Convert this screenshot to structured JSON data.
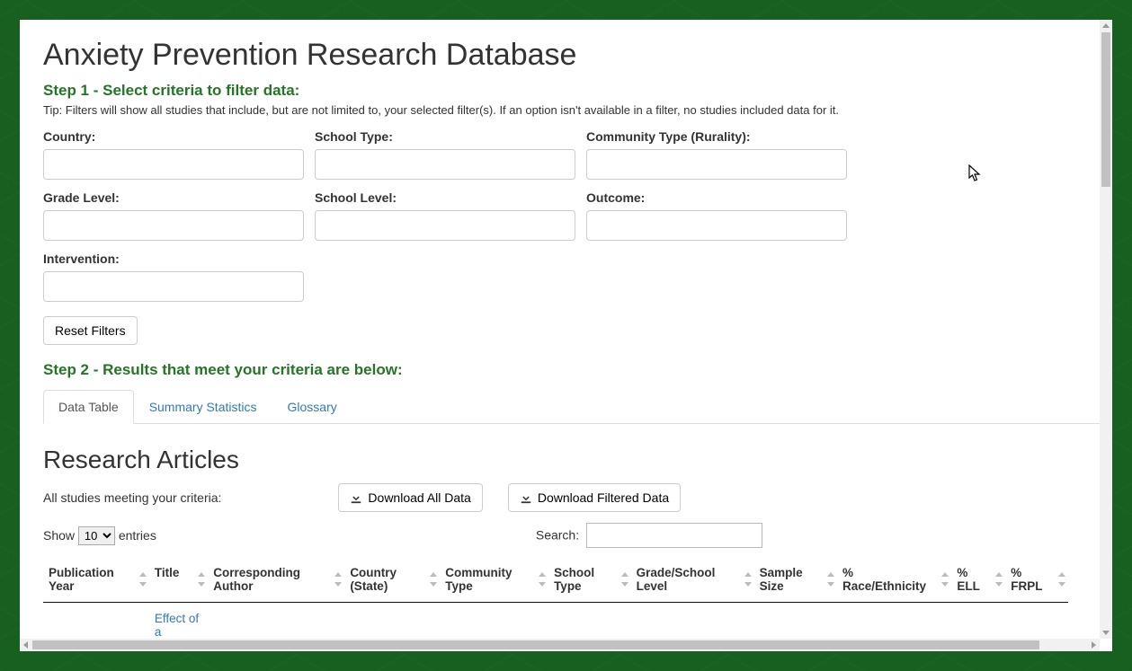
{
  "page": {
    "title": "Anxiety Prevention Research Database"
  },
  "step1": {
    "heading": "Step 1 - Select criteria to filter data:",
    "tip": "Tip: Filters will show all studies that include, but are not limited to, your selected filter(s). If an option isn't available in a filter, no studies included data for it."
  },
  "filters": {
    "country": "Country:",
    "school_type": "School Type:",
    "community_type": "Community Type (Rurality):",
    "grade_level": "Grade Level:",
    "school_level": "School Level:",
    "outcome": "Outcome:",
    "intervention": "Intervention:"
  },
  "buttons": {
    "reset": "Reset Filters",
    "download_all": "Download All Data",
    "download_filtered": "Download Filtered Data"
  },
  "step2": {
    "heading": "Step 2 - Results that meet your criteria are below:"
  },
  "tabs": {
    "data_table": "Data Table",
    "summary": "Summary Statistics",
    "glossary": "Glossary"
  },
  "results": {
    "section_title": "Research Articles",
    "criteria_text": "All studies meeting your criteria:",
    "show_label": "Show",
    "entries_label": "entries",
    "entries_value": "10",
    "search_label": "Search:"
  },
  "table": {
    "headers": {
      "pub_year": "Publication Year",
      "title": "Title",
      "author": "Corresponding Author",
      "country": "Country (State)",
      "community": "Community Type",
      "school_type": "School Type",
      "grade": "Grade/School Level",
      "sample": "Sample Size",
      "race": "% Race/Ethnicity",
      "ell": "% ELL",
      "frpl": "% FRPL"
    },
    "row0": {
      "title_snippet": "Effect of a"
    }
  }
}
